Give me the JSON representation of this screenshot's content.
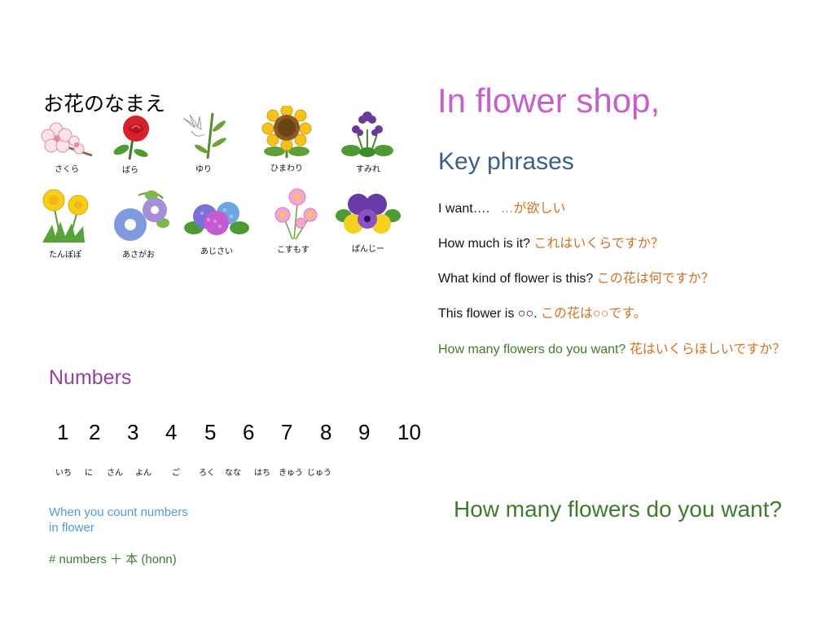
{
  "flowers": {
    "title": "お花のなまえ",
    "items": [
      {
        "label": "さくら"
      },
      {
        "label": "ばら"
      },
      {
        "label": "ゆり"
      },
      {
        "label": "ひまわり"
      },
      {
        "label": "すみれ"
      },
      {
        "label": "たんぽぽ"
      },
      {
        "label": "あさがお"
      },
      {
        "label": "あじさい"
      },
      {
        "label": "こすもす"
      },
      {
        "label": "ぱんじー"
      }
    ]
  },
  "shop": {
    "title": "In flower shop,",
    "key_title": "Key phrases",
    "phrases": [
      {
        "en": "I want….",
        "jp": "…が欲しい"
      },
      {
        "en": "How much is it?",
        "jp": "これはいくらですか？"
      },
      {
        "en": "What kind of flower is this?",
        "jp": "この花は何ですか？"
      },
      {
        "en": "This flower is ○○.",
        "jp": "この花は○○です。"
      },
      {
        "en": "How many flowers do you want?",
        "jp": "花はいくらほしいですか？"
      }
    ],
    "bottom_question": "How many flowers do you want?"
  },
  "numbers": {
    "title": "Numbers",
    "digits": [
      "1",
      "2",
      "3",
      "4",
      "5",
      "6",
      "7",
      "8",
      "9",
      "10"
    ],
    "readings": [
      "いち",
      "に",
      "さん",
      "よん",
      "ご",
      "ろく",
      "なな",
      "はち",
      "きゅう",
      "じゅう"
    ],
    "count_note_line1": "When you count numbers",
    "count_note_line2": "in flower",
    "count_rule": "# numbers ＋ 本 (honn)"
  },
  "colors": {
    "shop_title": "#c65fc7",
    "key_title": "#3d5f86",
    "japanese_text": "#d2711f",
    "green_text": "#3e7b2d",
    "numbers_title": "#983fa3",
    "count_note": "#4f9ed3"
  }
}
